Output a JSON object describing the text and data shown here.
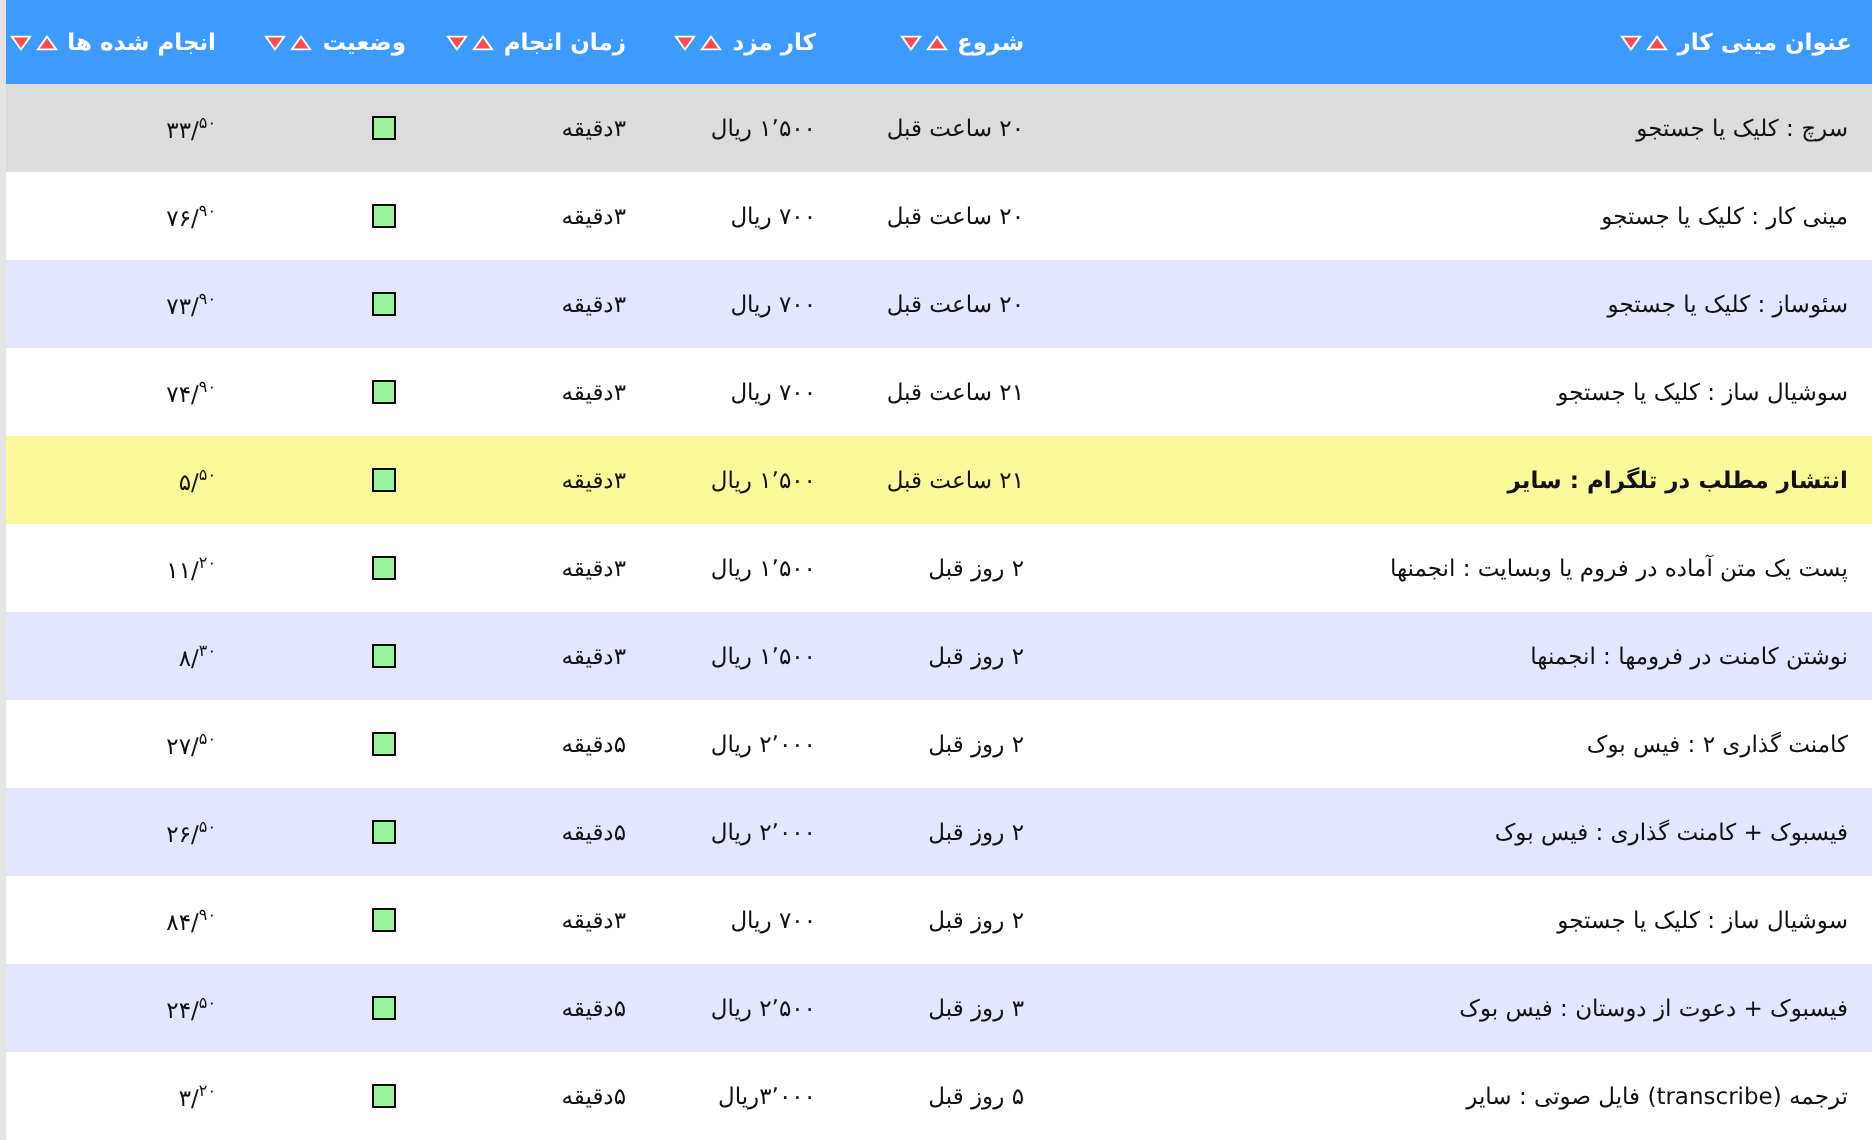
{
  "table": {
    "columns": [
      {
        "label": "عنوان مینی کار"
      },
      {
        "label": "شروع"
      },
      {
        "label": "کار مزد"
      },
      {
        "label": "زمان انجام"
      },
      {
        "label": "وضعیت"
      },
      {
        "label": "انجام شده ها"
      }
    ],
    "rows": [
      {
        "title": "سرچ : کلیک یا جستجو",
        "start": "۲۰ ساعت قبل",
        "wage": "۱٬۵۰۰ ریال",
        "duration": "۳دقیقه",
        "active": true,
        "done": "۳۳/$^{۵۰}$",
        "selected": true,
        "featured": false
      },
      {
        "title": "مینی کار : کلیک یا جستجو",
        "start": "۲۰ ساعت قبل",
        "wage": "۷۰۰ ریال",
        "duration": "۳دقیقه",
        "active": true,
        "done": "۷۶/$^{۹۰}$",
        "selected": false,
        "featured": false
      },
      {
        "title": "سئوساز : کلیک یا جستجو",
        "start": "۲۰ ساعت قبل",
        "wage": "۷۰۰ ریال",
        "duration": "۳دقیقه",
        "active": true,
        "done": "۷۳/$^{۹۰}$",
        "selected": false,
        "featured": false
      },
      {
        "title": "سوشیال ساز : کلیک یا جستجو",
        "start": "۲۱ ساعت قبل",
        "wage": "۷۰۰ ریال",
        "duration": "۳دقیقه",
        "active": true,
        "done": "۷۴/$^{۹۰}$",
        "selected": false,
        "featured": false
      },
      {
        "title": "انتشار مطلب در تلگرام : سایر",
        "start": "۲۱ ساعت قبل",
        "wage": "۱٬۵۰۰ ریال",
        "duration": "۳دقیقه",
        "active": true,
        "done": "۵/$^{۵۰}$",
        "selected": false,
        "featured": true
      },
      {
        "title": "پست یک متن آماده در فروم یا وبسایت : انجمنها",
        "start": "۲ روز قبل",
        "wage": "۱٬۵۰۰ ریال",
        "duration": "۳دقیقه",
        "active": true,
        "done": "۱۱/$^{۲۰}$",
        "selected": false,
        "featured": false
      },
      {
        "title": "نوشتن کامنت در فرومها : انجمنها",
        "start": "۲ روز قبل",
        "wage": "۱٬۵۰۰ ریال",
        "duration": "۳دقیقه",
        "active": true,
        "done": "۸/$^{۳۰}$",
        "selected": false,
        "featured": false
      },
      {
        "title": "کامنت گذاری ۲ : فیس بوک",
        "start": "۲ روز قبل",
        "wage": "۲٬۰۰۰ ریال",
        "duration": "۵دقیقه",
        "active": true,
        "done": "۲۷/$^{۵۰}$",
        "selected": false,
        "featured": false
      },
      {
        "title": "فیسبوک + کامنت گذاری : فیس بوک",
        "start": "۲ روز قبل",
        "wage": "۲٬۰۰۰ ریال",
        "duration": "۵دقیقه",
        "active": true,
        "done": "۲۶/$^{۵۰}$",
        "selected": false,
        "featured": false
      },
      {
        "title": "سوشیال ساز : کلیک یا جستجو",
        "start": "۲ روز قبل",
        "wage": "۷۰۰ ریال",
        "duration": "۳دقیقه",
        "active": true,
        "done": "۸۴/$^{۹۰}$",
        "selected": false,
        "featured": false
      },
      {
        "title": "فیسبوک + دعوت از دوستان : فیس بوک",
        "start": "۳ روز قبل",
        "wage": "۲٬۵۰۰ ریال",
        "duration": "۵دقیقه",
        "active": true,
        "done": "۲۴/$^{۵۰}$",
        "selected": false,
        "featured": false
      },
      {
        "title": "ترجمه (transcribe) فایل صوتی : سایر",
        "start": "۵ روز قبل",
        "wage": "۳٬۰۰۰ریال",
        "duration": "۵دقیقه",
        "active": true,
        "done": "۳/$^{۲۰}$",
        "selected": false,
        "featured": false
      }
    ]
  }
}
